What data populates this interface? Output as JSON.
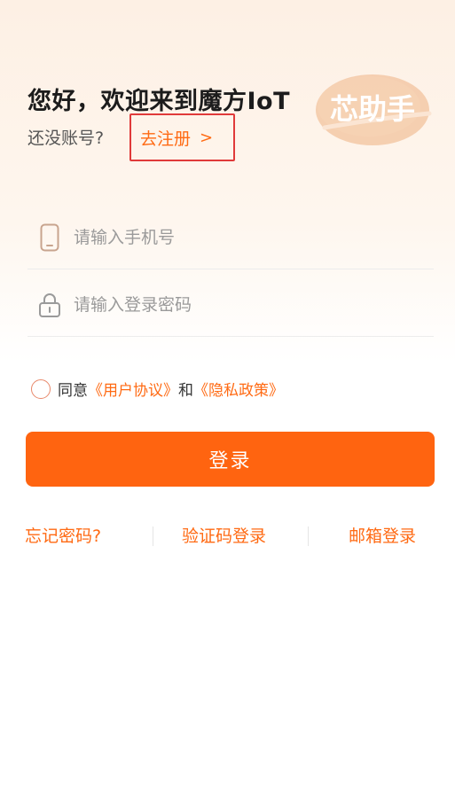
{
  "header": {
    "greeting": "您好，欢迎来到魔方IoT",
    "no_account": "还没账号?",
    "register_link": "去注册",
    "register_chevron": ">"
  },
  "logo": {
    "text": "芯助手",
    "icon": "logo-badge"
  },
  "form": {
    "phone_placeholder": "请输入手机号",
    "phone_icon": "phone-icon",
    "password_placeholder": "请输入登录密码",
    "password_icon": "lock-icon"
  },
  "agreement": {
    "prefix": "同意",
    "user_agreement": "《用户协议》",
    "and": "和",
    "privacy_policy": "《隐私政策》"
  },
  "login_button": "登录",
  "links": {
    "forgot_password": "忘记密码?",
    "sms_login": "验证码登录",
    "email_login": "邮箱登录"
  },
  "colors": {
    "accent": "#ff6410",
    "link": "#ff6a13",
    "highlight_border": "#e03a3a"
  }
}
